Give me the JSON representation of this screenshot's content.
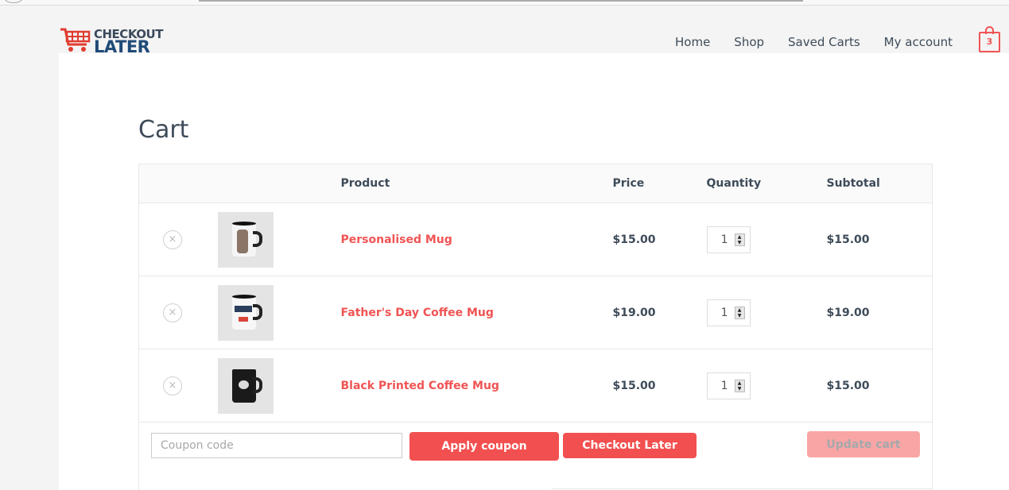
{
  "brand": {
    "line1": "CHECKOUT",
    "line2": "LATER",
    "accent": "#f05454",
    "dark": "#1f4a78"
  },
  "nav": {
    "items": [
      {
        "label": "Home"
      },
      {
        "label": "Shop"
      },
      {
        "label": "Saved Carts"
      },
      {
        "label": "My account"
      }
    ],
    "cart_count": "3"
  },
  "page": {
    "title": "Cart"
  },
  "table": {
    "headers": {
      "remove": "",
      "thumb": "",
      "product": "Product",
      "price": "Price",
      "quantity": "Quantity",
      "subtotal": "Subtotal"
    },
    "rows": [
      {
        "name": "Personalised Mug",
        "price": "$15.00",
        "qty": "1",
        "subtotal": "$15.00",
        "remove": "×",
        "image": "white-mug-photo"
      },
      {
        "name": "Father's Day Coffee Mug",
        "price": "$19.00",
        "qty": "1",
        "subtotal": "$19.00",
        "remove": "×",
        "image": "fathers-day-mug"
      },
      {
        "name": "Black Printed Coffee Mug",
        "price": "$15.00",
        "qty": "1",
        "subtotal": "$15.00",
        "remove": "×",
        "image": "black-mug"
      }
    ]
  },
  "actions": {
    "coupon_placeholder": "Coupon code",
    "apply_label": "Apply coupon",
    "checkout_later_label": "Checkout Later",
    "update_label": "Update cart"
  }
}
